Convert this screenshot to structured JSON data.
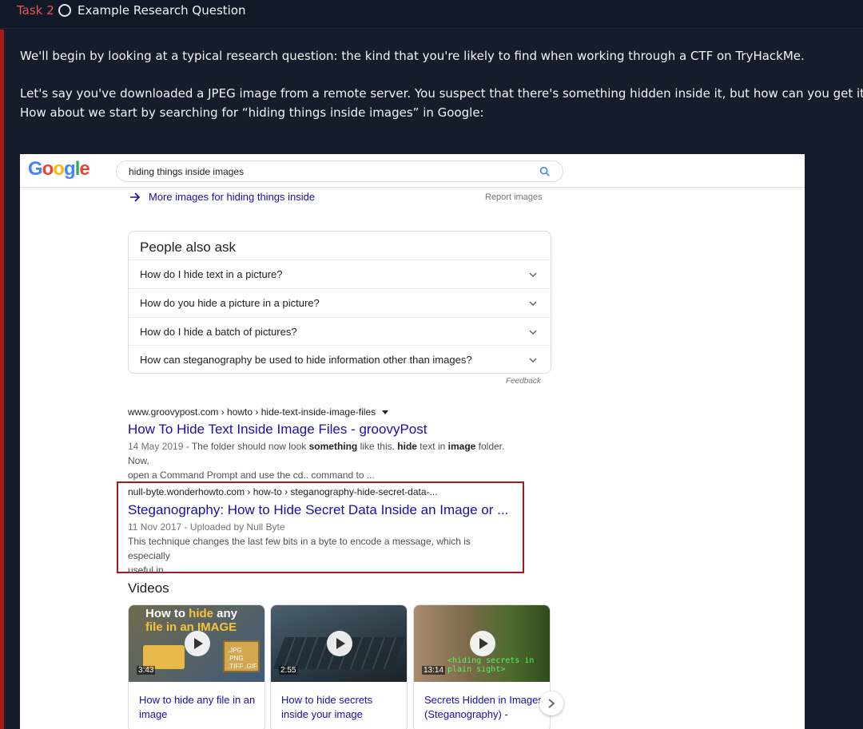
{
  "task": {
    "number": "Task 2",
    "title": "Example Research Question"
  },
  "intro": {
    "p1": "We'll begin by looking at a typical research question: the kind that you're likely to find when working through a CTF on TryHackMe.",
    "p2_line1": "Let's say you've downloaded a JPEG image from a remote server. You suspect that there's something hidden inside it, but how can you get it out?",
    "p2_line2": "How about we start by searching for “hiding things inside images” in Google:"
  },
  "google": {
    "search_query": "hiding things inside images",
    "more_images": "More images for hiding things inside",
    "report_images": "Report images",
    "people_also_ask": {
      "title": "People also ask",
      "questions": [
        "How do I hide text in a picture?",
        "How do you hide a picture in a picture?",
        "How do I hide a batch of pictures?",
        "How can steganography be used to hide information other than images?"
      ],
      "feedback": "Feedback"
    },
    "results": [
      {
        "url": "www.groovypost.com › howto › hide-text-inside-image-files",
        "title": "How To Hide Text Inside Image Files - groovyPost",
        "date": "14 May 2019",
        "snippet_l1_a": " - The folder should now look ",
        "snippet_l1_b": "something",
        "snippet_l1_c": " like this. ",
        "snippet_l1_d": "hide",
        "snippet_l1_e": " text in ",
        "snippet_l1_f": "image",
        "snippet_l1_g": " folder. Now,",
        "snippet_l2": "open a Command Prompt and use the cd.. command to ..."
      },
      {
        "url": "null-byte.wonderhowto.com › how-to › steganography-hide-secret-data-...",
        "title": "Steganography: How to Hide Secret Data Inside an Image or ...",
        "meta": "11 Nov 2017 - Uploaded by Null Byte",
        "snippet_l1": "This technique changes the last few bits in a byte to encode a message, which is especially",
        "snippet_l2": "useful in ..."
      }
    ],
    "videos": {
      "heading": "Videos",
      "items": [
        {
          "thumb_line1_a": "How to ",
          "thumb_line1_b": "hide",
          "thumb_line1_c": " any",
          "thumb_line2": "file in an IMAGE",
          "thumb_box": ".JPG .PNG .TIFF .GIF",
          "duration": "3:43",
          "title": "How to hide any file in an image"
        },
        {
          "duration": "2:55",
          "title": "How to hide secrets inside your image"
        },
        {
          "thumb_text": "<hiding secrets in plain sight>",
          "duration": "13:14",
          "title": "Secrets Hidden in Images (Steganography) -"
        }
      ]
    }
  },
  "colors": {
    "accent_red": "#a61b1b",
    "task_red": "#e55656",
    "link_blue": "#1a0dab",
    "bg": "#151c2b"
  }
}
